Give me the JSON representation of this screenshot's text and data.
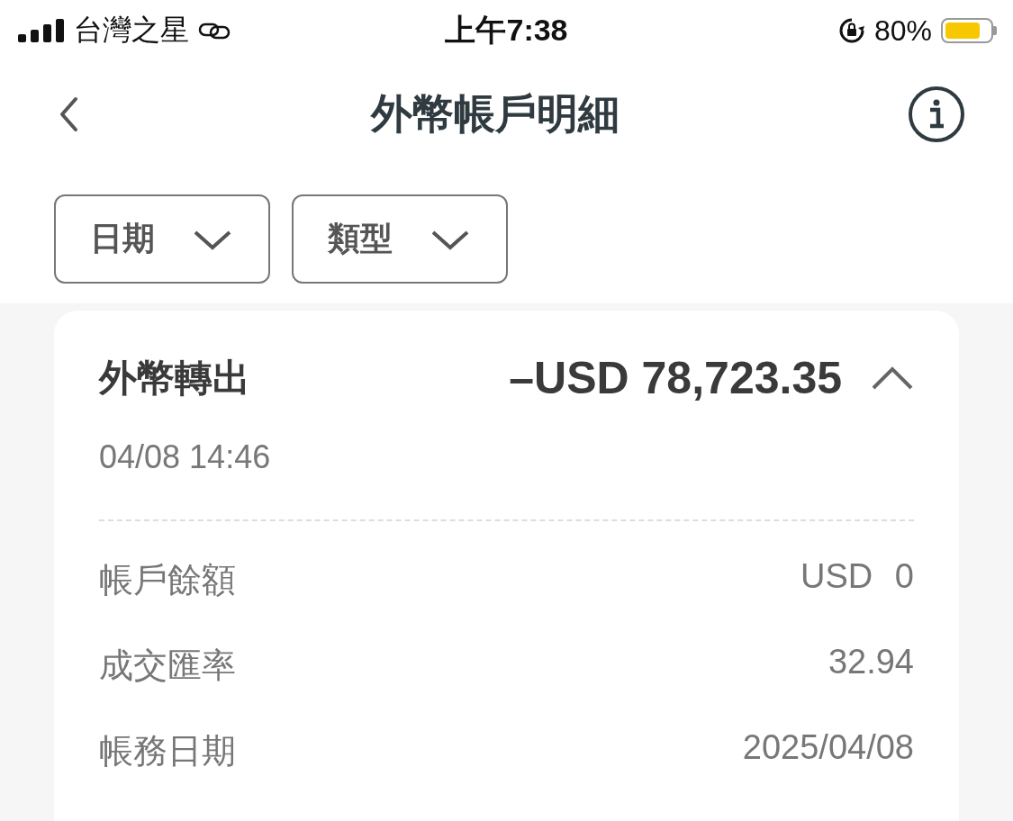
{
  "status_bar": {
    "carrier": "台灣之星",
    "time": "上午7:38",
    "battery_percent": "80%",
    "battery": {
      "level": 0.8
    }
  },
  "header": {
    "title": "外幣帳戶明細"
  },
  "filters": [
    {
      "label": "日期"
    },
    {
      "label": "類型"
    }
  ],
  "transaction": {
    "type": "外幣轉出",
    "amount": "–USD 78,723.35",
    "expanded": true,
    "datetime": "04/08 14:46",
    "details": [
      {
        "label": "帳戶餘額",
        "value": "USD 0"
      },
      {
        "label": "成交匯率",
        "value": "32.94"
      },
      {
        "label": "帳務日期",
        "value": "2025/04/08"
      }
    ]
  }
}
